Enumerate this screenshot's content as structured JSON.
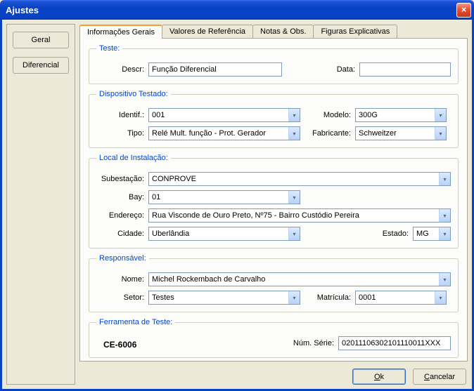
{
  "window": {
    "title": "Ajustes"
  },
  "nav": {
    "geral": "Geral",
    "diferencial": "Diferencial"
  },
  "tabs": {
    "t0": "Informações Gerais",
    "t1": "Valores de Referência",
    "t2": "Notas & Obs.",
    "t3": "Figuras Explicativas"
  },
  "teste": {
    "legend": "Teste:",
    "descr_lbl": "Descr:",
    "descr": "Função Diferencial",
    "data_lbl": "Data:",
    "data": ""
  },
  "dispositivo": {
    "legend": "Dispositivo Testado:",
    "identif_lbl": "Identif.:",
    "identif": "001",
    "modelo_lbl": "Modelo:",
    "modelo": "300G",
    "tipo_lbl": "Tipo:",
    "tipo": "Relé Mult. função - Prot. Gerador",
    "fabricante_lbl": "Fabricante:",
    "fabricante": "Schweitzer"
  },
  "local": {
    "legend": "Local de Instalação:",
    "subestacao_lbl": "Subestação:",
    "subestacao": "CONPROVE",
    "bay_lbl": "Bay:",
    "bay": "01",
    "endereco_lbl": "Endereço:",
    "endereco": "Rua Visconde de Ouro Preto, Nº75 - Bairro Custódio Pereira",
    "cidade_lbl": "Cidade:",
    "cidade": "Uberlândia",
    "estado_lbl": "Estado:",
    "estado": "MG"
  },
  "responsavel": {
    "legend": "Responsável:",
    "nome_lbl": "Nome:",
    "nome": "Michel Rockembach de Carvalho",
    "setor_lbl": "Setor:",
    "setor": "Testes",
    "matricula_lbl": "Matrícula:",
    "matricula": "0001"
  },
  "ferramenta": {
    "legend": "Ferramenta de Teste:",
    "name": "CE-6006",
    "numserie_lbl": "Núm. Série:",
    "numserie": "02011106302101110011XXX"
  },
  "buttons": {
    "ok": "Ok",
    "cancel": "Cancelar"
  }
}
